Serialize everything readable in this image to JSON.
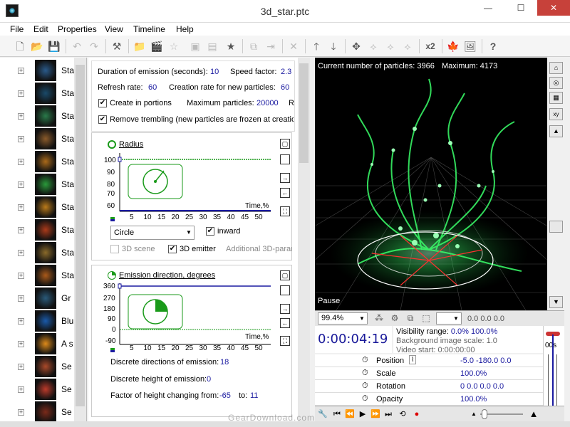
{
  "window": {
    "title": "3d_star.ptc",
    "minimize": "—",
    "maximize": "☐",
    "close": "✕"
  },
  "menu": [
    "File",
    "Edit",
    "Properties",
    "View",
    "Timeline",
    "Help"
  ],
  "toolbar": {
    "x2_label": "x2",
    "help_label": "?"
  },
  "tree": {
    "items": [
      {
        "label": "Sta",
        "thumb": "#2a5a8a"
      },
      {
        "label": "Sta",
        "thumb": "#1a4a6a"
      },
      {
        "label": "Sta",
        "thumb": "#2a7a4a"
      },
      {
        "label": "Sta",
        "thumb": "#8a5a2a"
      },
      {
        "label": "Sta",
        "thumb": "#aa6a1a"
      },
      {
        "label": "Sta",
        "thumb": "#2a9a3a"
      },
      {
        "label": "Sta",
        "thumb": "#ba7a1a"
      },
      {
        "label": "Sta",
        "thumb": "#aa3a1a"
      },
      {
        "label": "Sta",
        "thumb": "#8a6a2a"
      },
      {
        "label": "Sta",
        "thumb": "#aa5a1a"
      },
      {
        "label": "Gr",
        "thumb": "#2a5a7a"
      },
      {
        "label": "Blu",
        "thumb": "#1a5aaa"
      },
      {
        "label": "A s",
        "thumb": "#dd8a1a"
      },
      {
        "label": "Se",
        "thumb": "#aa4a2a"
      },
      {
        "label": "Se",
        "thumb": "#bb3a2a"
      },
      {
        "label": "Se",
        "thumb": "#7a2a1a"
      }
    ]
  },
  "props": {
    "duration_label": "Duration of emission (seconds):",
    "duration_value": "10",
    "speed_label": "Speed factor:",
    "speed_value": "2.3",
    "refresh_label": "Refresh rate:",
    "refresh_value": "60",
    "creation_label": "Creation rate for new particles:",
    "creation_value": "60",
    "portions_label": "Create in portions",
    "max_label": "Maximum particles:",
    "max_value": "20000",
    "max_extra": "R",
    "trembling_label": "Remove trembling (new particles are frozen at creatio"
  },
  "radius": {
    "title": "Radius",
    "y_ticks": [
      "100",
      "90",
      "80",
      "70",
      "60"
    ],
    "x_ticks": [
      "5",
      "10",
      "15",
      "20",
      "25",
      "30",
      "35",
      "40",
      "45",
      "50"
    ],
    "axis_label": "Time,%",
    "shape": "Circle",
    "inward_label": "inward",
    "scene_label": "3D scene",
    "emitter_label": "3D emitter",
    "additional_label": "Additional 3D-paran"
  },
  "emission": {
    "title": "Emission direction, degrees",
    "y_ticks": [
      "360",
      "270",
      "180",
      "90",
      "0",
      "-90"
    ],
    "x_ticks": [
      "5",
      "10",
      "15",
      "20",
      "25",
      "30",
      "35",
      "40",
      "45",
      "50"
    ],
    "axis_label": "Time,%",
    "discrete_dir_label": "Discrete directions of emission:",
    "discrete_dir_value": "18",
    "discrete_h_label": "Discrete height of emission:",
    "discrete_h_value": "0",
    "factor_label": "Factor of height changing from:",
    "factor_from": "-65",
    "factor_to_label": "to:",
    "factor_to": "11"
  },
  "viewport": {
    "particles_label": "Current number of particles:",
    "particles_value": "3966",
    "maximum_label": "Maximum:",
    "maximum_value": "4173",
    "pause_label": "Pause",
    "zoom": "99.4%",
    "coords": "0.0   0.0   0.0"
  },
  "timeline": {
    "time": "0:00:04:19",
    "visibility_label": "Visibility range:",
    "visibility_from": "0.0%",
    "visibility_to": "100.0%",
    "bg_scale": "Background image scale: 1.0",
    "video_start": "Video start: 0:00:00:00",
    "ruler_label": "00s",
    "rows": [
      {
        "name": "Position",
        "value": "-5.0   -180.0   0.0"
      },
      {
        "name": "Scale",
        "value": "100.0%"
      },
      {
        "name": "Rotation",
        "value": "0   0.0   0.0   0.0"
      },
      {
        "name": "Opacity",
        "value": "100.0%"
      }
    ]
  },
  "watermark": "GearDownload.com",
  "colors": {
    "accent_green": "#1a9a1a",
    "value_blue": "#1a1aa0",
    "timecode_blue": "#1a1a9a",
    "particle_green": "#3aff6a"
  }
}
